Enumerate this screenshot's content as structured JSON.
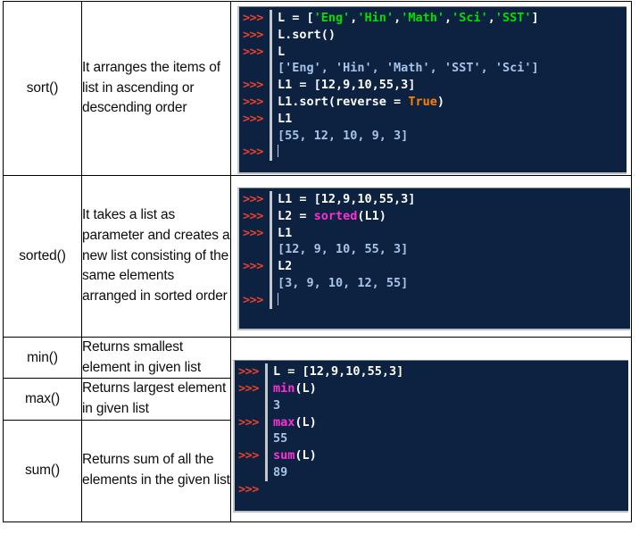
{
  "document": {
    "title": "Python List Functions Reference Table",
    "type": "table"
  },
  "table": {
    "rows": [
      {
        "function": "sort()",
        "description": "It arranges the items of list in ascending or descending order"
      },
      {
        "function": "sorted()",
        "description": "It takes a list as parameter and creates a new list consisting of the same elements arranged in sorted order"
      },
      {
        "function": "min()",
        "description": "Returns smallest element in given list"
      },
      {
        "function": "max()",
        "description": "Returns largest element in given list"
      },
      {
        "function": "sum()",
        "description": "Returns sum of all the elements in the given list"
      }
    ]
  },
  "consoles": {
    "prompt": ">>>",
    "block1": {
      "lines": [
        {
          "prompt": true,
          "parts": [
            {
              "t": "L = [",
              "k": "code"
            },
            {
              "t": "'Eng'",
              "k": "str"
            },
            {
              "t": ",",
              "k": "code"
            },
            {
              "t": "'Hin'",
              "k": "str"
            },
            {
              "t": ",",
              "k": "code"
            },
            {
              "t": "'Math'",
              "k": "str"
            },
            {
              "t": ",",
              "k": "code"
            },
            {
              "t": "'Sci'",
              "k": "str"
            },
            {
              "t": ",",
              "k": "code"
            },
            {
              "t": "'SST'",
              "k": "str"
            },
            {
              "t": "]",
              "k": "code"
            }
          ]
        },
        {
          "prompt": true,
          "parts": [
            {
              "t": "L.sort()",
              "k": "code"
            }
          ]
        },
        {
          "prompt": true,
          "parts": [
            {
              "t": "L",
              "k": "code"
            }
          ]
        },
        {
          "prompt": false,
          "parts": [
            {
              "t": "['Eng', 'Hin', 'Math', 'SST', 'Sci']",
              "k": "out"
            }
          ]
        },
        {
          "prompt": true,
          "parts": [
            {
              "t": "L1 = [12,9,10,55,3]",
              "k": "code"
            }
          ]
        },
        {
          "prompt": true,
          "parts": [
            {
              "t": "L1.sort(reverse = ",
              "k": "code"
            },
            {
              "t": "True",
              "k": "kw"
            },
            {
              "t": ")",
              "k": "code"
            }
          ]
        },
        {
          "prompt": true,
          "parts": [
            {
              "t": "L1",
              "k": "code"
            }
          ]
        },
        {
          "prompt": false,
          "parts": [
            {
              "t": "[55, 12, 10, 9, 3]",
              "k": "out"
            }
          ]
        },
        {
          "prompt": true,
          "parts": [
            {
              "t": "",
              "k": "caret"
            }
          ]
        }
      ]
    },
    "block2": {
      "lines": [
        {
          "prompt": true,
          "parts": [
            {
              "t": "L1 = [12,9,10,55,3]",
              "k": "code"
            }
          ]
        },
        {
          "prompt": true,
          "parts": [
            {
              "t": "L2 = ",
              "k": "code"
            },
            {
              "t": "sorted",
              "k": "fn"
            },
            {
              "t": "(L1)",
              "k": "code"
            }
          ]
        },
        {
          "prompt": true,
          "parts": [
            {
              "t": "L1",
              "k": "code"
            }
          ]
        },
        {
          "prompt": false,
          "parts": [
            {
              "t": "[12, 9, 10, 55, 3]",
              "k": "out"
            }
          ]
        },
        {
          "prompt": true,
          "parts": [
            {
              "t": "L2",
              "k": "code"
            }
          ]
        },
        {
          "prompt": false,
          "parts": [
            {
              "t": "[3, 9, 10, 12, 55]",
              "k": "out"
            }
          ]
        },
        {
          "prompt": true,
          "parts": [
            {
              "t": "",
              "k": "caret"
            }
          ]
        }
      ]
    },
    "block3": {
      "lines": [
        {
          "prompt": true,
          "parts": [
            {
              "t": "L = [12,9,10,55,3]",
              "k": "code"
            }
          ]
        },
        {
          "prompt": true,
          "parts": [
            {
              "t": "min",
              "k": "fn"
            },
            {
              "t": "(L)",
              "k": "code"
            }
          ]
        },
        {
          "prompt": false,
          "parts": [
            {
              "t": "3",
              "k": "out"
            }
          ]
        },
        {
          "prompt": true,
          "parts": [
            {
              "t": "max",
              "k": "fn"
            },
            {
              "t": "(L)",
              "k": "code"
            }
          ]
        },
        {
          "prompt": false,
          "parts": [
            {
              "t": "55",
              "k": "out"
            }
          ]
        },
        {
          "prompt": true,
          "parts": [
            {
              "t": "sum",
              "k": "fn"
            },
            {
              "t": "(L)",
              "k": "code"
            }
          ]
        },
        {
          "prompt": false,
          "parts": [
            {
              "t": "89",
              "k": "out"
            }
          ]
        },
        {
          "prompt": true,
          "parts": [
            {
              "t": "",
              "k": "none"
            }
          ]
        }
      ]
    }
  },
  "colors": {
    "console_bg": "#0d2240",
    "prompt": "#e8412c",
    "code": "#ffffff",
    "string": "#00e000",
    "builtin": "#ff2fd6",
    "keyword": "#ff8000",
    "output": "#a7c3e8",
    "border": "#000000"
  }
}
